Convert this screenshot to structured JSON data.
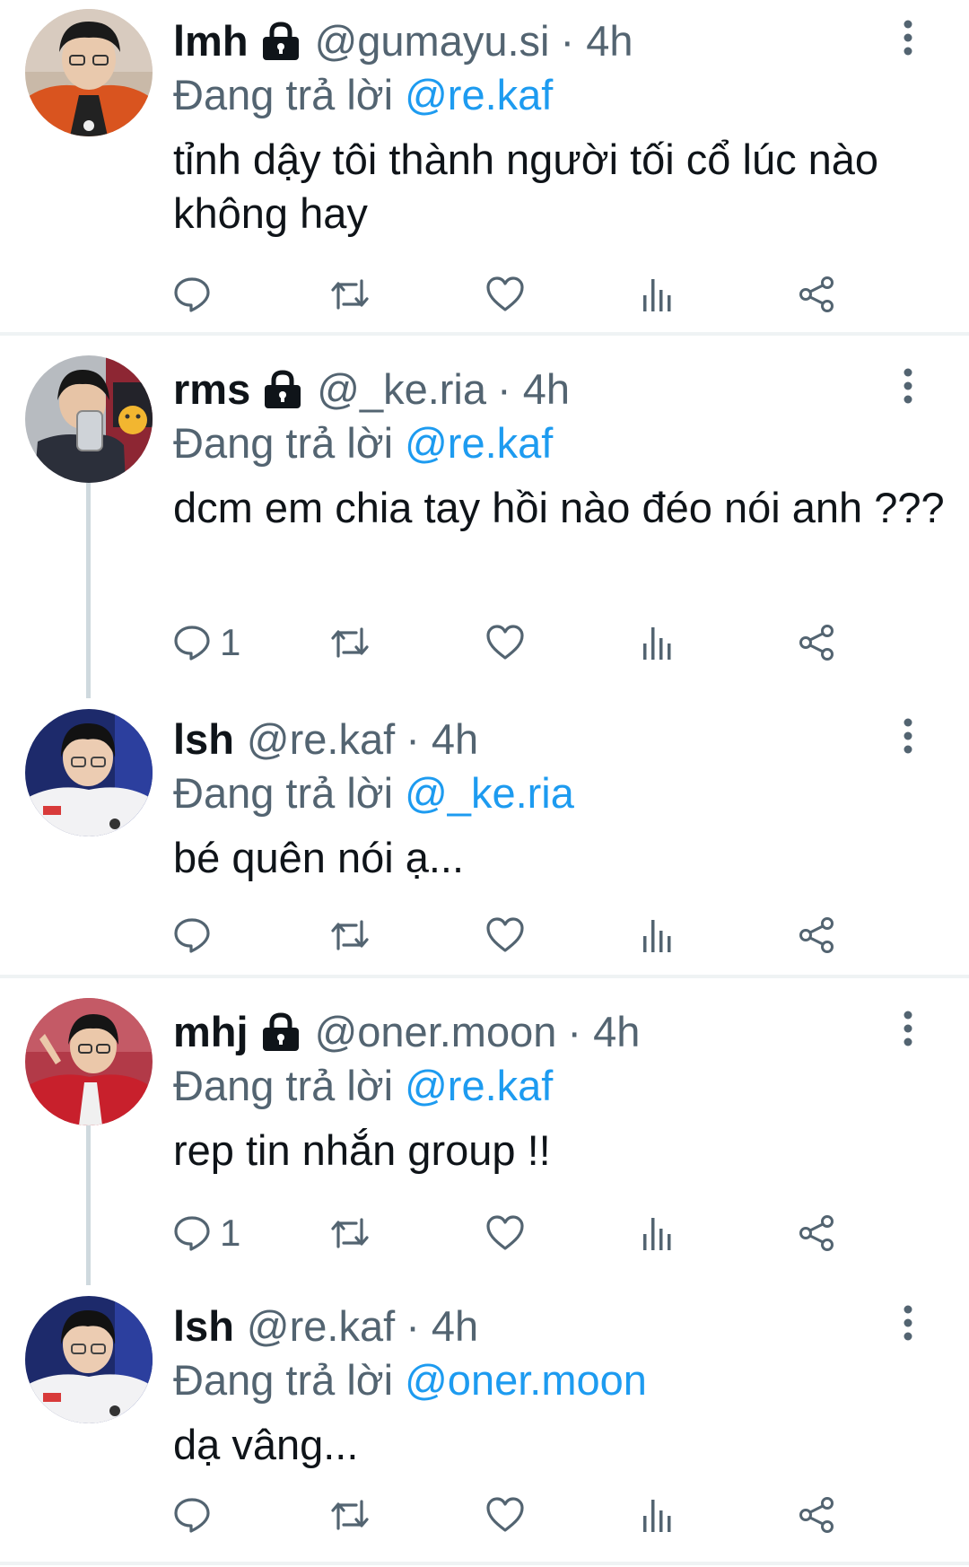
{
  "tweets": [
    {
      "name": "lmh",
      "locked": true,
      "handle": "@gumayu.si",
      "time": "· 4h",
      "reply_prefix": "Đang trả lời ",
      "reply_to": "@re.kaf",
      "text": "tỉnh dậy tôi thành người tối cổ lúc nào không hay",
      "reply_count": "",
      "avatar_icon": "avatar-red-jacket"
    },
    {
      "name": "rms",
      "locked": true,
      "handle": "@_ke.ria",
      "time": "· 4h",
      "reply_prefix": "Đang trả lời ",
      "reply_to": "@re.kaf",
      "text": "dcm em chia tay hồi nào đéo nói anh ???",
      "reply_count": "1",
      "avatar_icon": "avatar-mirror-selfie"
    },
    {
      "name": "lsh",
      "locked": false,
      "handle": "@re.kaf",
      "time": "· 4h",
      "reply_prefix": "Đang trả lời ",
      "reply_to": "@_ke.ria",
      "text": "bé quên nói ạ...",
      "reply_count": "",
      "avatar_icon": "avatar-white-jacket"
    },
    {
      "name": "mhj",
      "locked": true,
      "handle": "@oner.moon",
      "time": "· 4h",
      "reply_prefix": "Đang trả lời ",
      "reply_to": "@re.kaf",
      "text": "rep tin nhắn group !!",
      "reply_count": "1",
      "avatar_icon": "avatar-red-jacket-pose"
    },
    {
      "name": "lsh",
      "locked": false,
      "handle": "@re.kaf",
      "time": "· 4h",
      "reply_prefix": "Đang trả lời ",
      "reply_to": "@oner.moon",
      "text": "dạ vâng...",
      "reply_count": "",
      "avatar_icon": "avatar-white-jacket"
    }
  ],
  "colors": {
    "text": "#0f1419",
    "secondary": "#536471",
    "accent": "#1d9bf0",
    "divider": "#eff3f4",
    "thread_line": "#cfd9de"
  },
  "icons": {
    "reply": "reply-icon",
    "retweet": "retweet-icon",
    "like": "heart-icon",
    "views": "views-icon",
    "share": "share-icon",
    "more": "more-icon",
    "lock": "lock-icon"
  }
}
